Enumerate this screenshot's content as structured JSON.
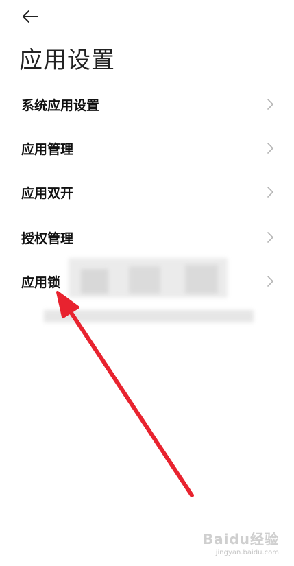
{
  "header": {
    "back_icon": "arrow-left-icon",
    "title": "应用设置"
  },
  "menu": {
    "items": [
      {
        "label": "系统应用设置",
        "icon": "chevron-right-icon"
      },
      {
        "label": "应用管理",
        "icon": "chevron-right-icon"
      },
      {
        "label": "应用双开",
        "icon": "chevron-right-icon"
      },
      {
        "label": "授权管理",
        "icon": "chevron-right-icon"
      },
      {
        "label": "应用锁",
        "icon": "chevron-right-icon"
      }
    ]
  },
  "annotation": {
    "arrow_color": "#e8232f"
  },
  "watermark": {
    "brand": "Baidu经验",
    "url": "jingyan.baidu.com"
  }
}
